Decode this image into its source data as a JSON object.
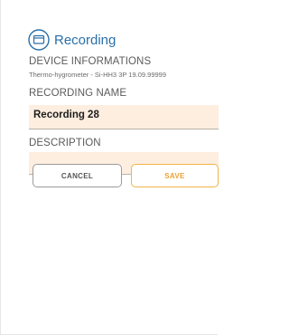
{
  "header": {
    "title": "Recording",
    "icon": "recording-icon"
  },
  "device": {
    "label": "DEVICE INFORMATIONS",
    "value": "Thermo-hygrometer - Si-HH3 3P 19.09.99999"
  },
  "recording_name": {
    "label": "RECORDING NAME",
    "value": "Recording 28"
  },
  "description": {
    "label": "DESCRIPTION",
    "value": ""
  },
  "actions": {
    "cancel_label": "CANCEL",
    "save_label": "SAVE"
  },
  "colors": {
    "accent": "#2a6fa8",
    "field_bg": "#fdeee0",
    "save": "#f0a030"
  }
}
